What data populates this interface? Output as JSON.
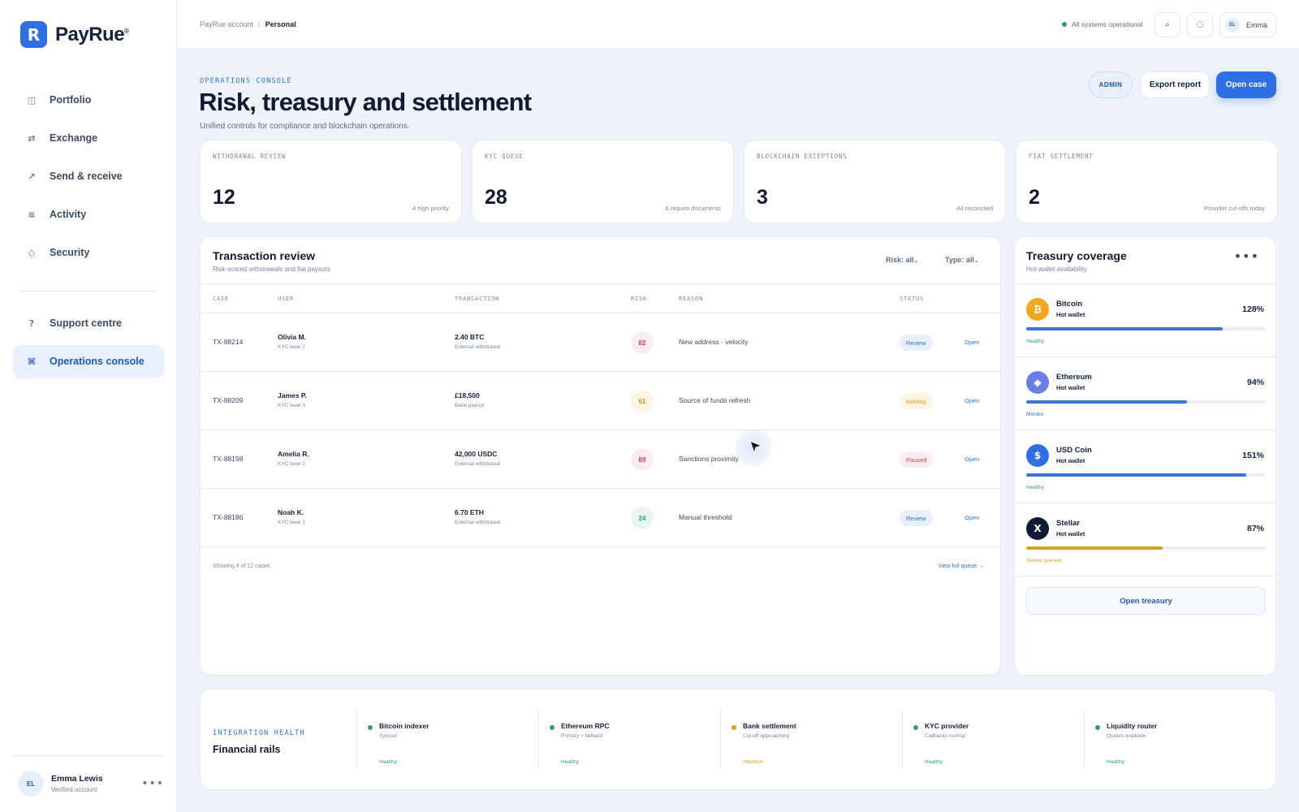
{
  "brand": {
    "logo_letter": "R",
    "name": "PayRue",
    "trademark": "®"
  },
  "sidebar": {
    "nav": [
      {
        "icon": "grid-icon",
        "glyph": "◫",
        "label": "Portfolio"
      },
      {
        "icon": "swap-icon",
        "glyph": "⇄",
        "label": "Exchange"
      },
      {
        "icon": "arrow-up-right-icon",
        "glyph": "↗",
        "label": "Send & receive"
      },
      {
        "icon": "list-icon",
        "glyph": "≡",
        "label": "Activity"
      },
      {
        "icon": "shield-icon",
        "glyph": "◇",
        "label": "Security"
      }
    ],
    "secondary": [
      {
        "icon": "help-icon",
        "glyph": "?",
        "label": "Support centre"
      },
      {
        "icon": "command-icon",
        "glyph": "⌘",
        "label": "Operations console",
        "active": true
      }
    ],
    "user": {
      "initials": "EL",
      "name": "Emma Lewis",
      "status": "Verified account",
      "more": "•••"
    }
  },
  "topbar": {
    "breadcrumb": {
      "parent": "PayRue account",
      "separator": "/",
      "current": "Personal"
    },
    "system_status": "All systems operational",
    "search_glyph": "⌕",
    "notifications_glyph": "◌",
    "user": {
      "initials": "EL",
      "name": "Emma"
    }
  },
  "header": {
    "eyebrow": "OPERATIONS CONSOLE",
    "title": "Risk, treasury and settlement",
    "subtitle": "Unified controls for compliance and blockchain operations.",
    "role_badge": "ADMIN",
    "export_label": "Export report",
    "open_case_label": "Open case"
  },
  "kpis": [
    {
      "label": "WITHDRAWAL REVIEW",
      "value": "12",
      "note": "4 high priority"
    },
    {
      "label": "KYC QUEUE",
      "value": "28",
      "note": "6 require documents"
    },
    {
      "label": "BLOCKCHAIN EXCEPTIONS",
      "value": "3",
      "note": "All reconciled"
    },
    {
      "label": "FIAT SETTLEMENT",
      "value": "2",
      "note": "Provider cut-offs today"
    }
  ],
  "transactions": {
    "title": "Transaction review",
    "subtitle": "Risk-scored withdrawals and fiat payouts",
    "filters": {
      "risk": "Risk: all",
      "type": "Type: all"
    },
    "columns": [
      "CASE",
      "USER",
      "TRANSACTION",
      "RISK",
      "REASON",
      "STATUS"
    ],
    "rows": [
      {
        "case": "TX-88214",
        "user": "Olivia M.",
        "kyc": "KYC level 2",
        "amount": "2.40 BTC",
        "kind": "External withdrawal",
        "risk": "82",
        "level": "red",
        "reason": "New address · velocity",
        "status": "Review",
        "status_kind": "review",
        "action": "Open"
      },
      {
        "case": "TX-88209",
        "user": "James P.",
        "kyc": "KYC level 3",
        "amount": "£18,500",
        "kind": "Bank payout",
        "risk": "61",
        "level": "amber",
        "reason": "Source of funds refresh",
        "status": "Waiting",
        "status_kind": "waiting",
        "action": "Open"
      },
      {
        "case": "TX-88198",
        "user": "Amelia R.",
        "kyc": "KYC level 2",
        "amount": "42,000 USDC",
        "kind": "External withdrawal",
        "risk": "89",
        "level": "red",
        "reason": "Sanctions proximity",
        "status": "Paused",
        "status_kind": "paused",
        "action": "Open"
      },
      {
        "case": "TX-88186",
        "user": "Noah K.",
        "kyc": "KYC level 1",
        "amount": "6.70 ETH",
        "kind": "External withdrawal",
        "risk": "24",
        "level": "green",
        "reason": "Manual threshold",
        "status": "Review",
        "status_kind": "review",
        "action": "Open"
      }
    ],
    "footer_count": "Showing 4 of 12 cases",
    "footer_link": "View full queue →"
  },
  "treasury": {
    "title": "Treasury coverage",
    "subtitle": "Hot-wallet availability",
    "more": "•••",
    "assets": [
      {
        "icon": "bitcoin-icon",
        "glyph": "₿",
        "coin_color": "#f2a81d",
        "name": "Bitcoin",
        "wallet": "Hot wallet",
        "pct": "128%",
        "fill": 0.82,
        "bar_color": "#3b74d9",
        "state": "Healthy",
        "state_color": "#2aa36b"
      },
      {
        "icon": "ethereum-icon",
        "glyph": "◆",
        "coin_color": "#6b7ee8",
        "name": "Ethereum",
        "wallet": "Hot wallet",
        "pct": "94%",
        "fill": 0.67,
        "bar_color": "#3b74d9",
        "state": "Monitor",
        "state_color": "#2f6fe4"
      },
      {
        "icon": "usd-coin-icon",
        "glyph": "$",
        "coin_color": "#2f6fe4",
        "name": "USD Coin",
        "wallet": "Hot wallet",
        "pct": "151%",
        "fill": 0.92,
        "bar_color": "#3b74d9",
        "state": "Healthy",
        "state_color": "#2aa36b"
      },
      {
        "icon": "stellar-icon",
        "glyph": "X",
        "coin_color": "#0f1b33",
        "name": "Stellar",
        "wallet": "Hot wallet",
        "pct": "87%",
        "fill": 0.57,
        "bar_color": "#d4a02a",
        "state": "Sweep queued",
        "state_color": "#d4a02a"
      }
    ],
    "button": "Open treasury"
  },
  "integrations": {
    "eyebrow": "INTEGRATION HEALTH",
    "title": "Financial rails",
    "items": [
      {
        "name": "Bitcoin indexer",
        "sub": "Synced",
        "state": "Healthy",
        "color": "#2aa36b"
      },
      {
        "name": "Ethereum RPC",
        "sub": "Primary + fallback",
        "state": "Healthy",
        "color": "#2aa36b"
      },
      {
        "name": "Bank settlement",
        "sub": "Cut-off approaching",
        "state": "Attention",
        "color": "#d4a02a"
      },
      {
        "name": "KYC provider",
        "sub": "Callbacks normal",
        "state": "Healthy",
        "color": "#2aa36b"
      },
      {
        "name": "Liquidity router",
        "sub": "Quotes available",
        "state": "Healthy",
        "color": "#2aa36b"
      }
    ]
  }
}
